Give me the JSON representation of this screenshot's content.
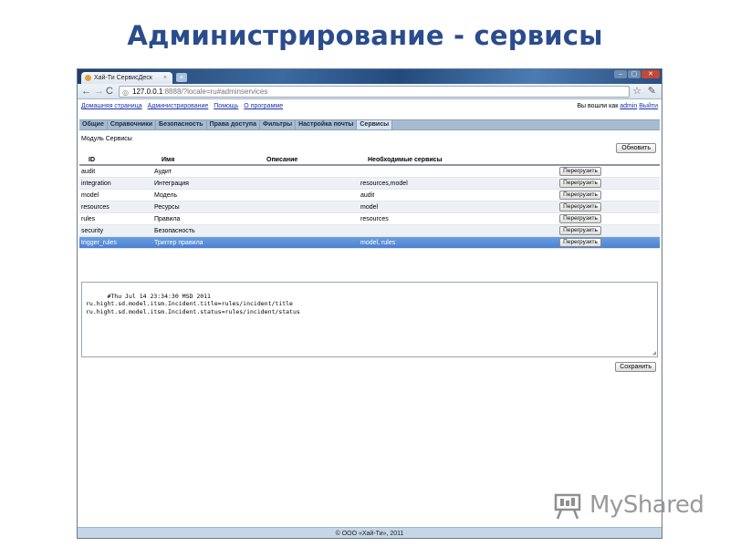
{
  "slide": {
    "title": "Администрирование - сервисы"
  },
  "browser": {
    "tab_title": "Хай-Ти СервисДеск",
    "tab_close": "×",
    "new_tab": "+",
    "window_buttons": [
      "–",
      "▢",
      "✕"
    ],
    "url_host": "127.0.0.1",
    "url_rest": ":8888/?locale=ru#adminservices"
  },
  "page": {
    "top_links": [
      "Домашняя страница",
      "Администрирование",
      "Помощь",
      "О программе"
    ],
    "user_prefix": "Вы вошли как",
    "user_name": "admin",
    "logout": "Выйти",
    "nav_tabs": [
      {
        "label": "Общие",
        "active": false
      },
      {
        "label": "Справочники",
        "active": false
      },
      {
        "label": "Безопасность",
        "active": false
      },
      {
        "label": "Права доступа",
        "active": false
      },
      {
        "label": "Фильтры",
        "active": false
      },
      {
        "label": "Настройка почты",
        "active": false
      },
      {
        "label": "Сервисы",
        "active": true
      }
    ],
    "module_label": "Модуль Сервисы",
    "refresh_label": "Обновить",
    "grid": {
      "columns": [
        "ID",
        "Имя",
        "Описание",
        "Необходимые сервисы"
      ],
      "reload_label": "Перегрузить",
      "rows": [
        {
          "id": "audit",
          "name": "Аудит",
          "desc": "",
          "deps": ""
        },
        {
          "id": "integration",
          "name": "Интеграция",
          "desc": "",
          "deps": "resources,model"
        },
        {
          "id": "model",
          "name": "Модель",
          "desc": "",
          "deps": "audit"
        },
        {
          "id": "resources",
          "name": "Ресурсы",
          "desc": "",
          "deps": "model"
        },
        {
          "id": "rules",
          "name": "Правила",
          "desc": "",
          "deps": "resources"
        },
        {
          "id": "security",
          "name": "Безопасность",
          "desc": "",
          "deps": ""
        },
        {
          "id": "trigger_rules",
          "name": "Триггер правила",
          "desc": "",
          "deps": "model, rules",
          "selected": true
        }
      ]
    },
    "editor_text": "#Thu Jul 14 23:34:30 MSD 2011\nru.hight.sd.model.itsm.Incident.title=rules/incident/title\nru.hight.sd.model.itsm.Incident.status=rules/incident/status",
    "save_label": "Сохранить",
    "footer": "© ООО «Хай-Ти», 2011"
  },
  "watermark": {
    "text": "MyShared"
  },
  "colors": {
    "title": "#2a4c8c",
    "nav_bar": "#a5bbd2",
    "selected_row": "#4a80d0",
    "link": "#1a33aa",
    "footer": "#c5d6e6"
  }
}
